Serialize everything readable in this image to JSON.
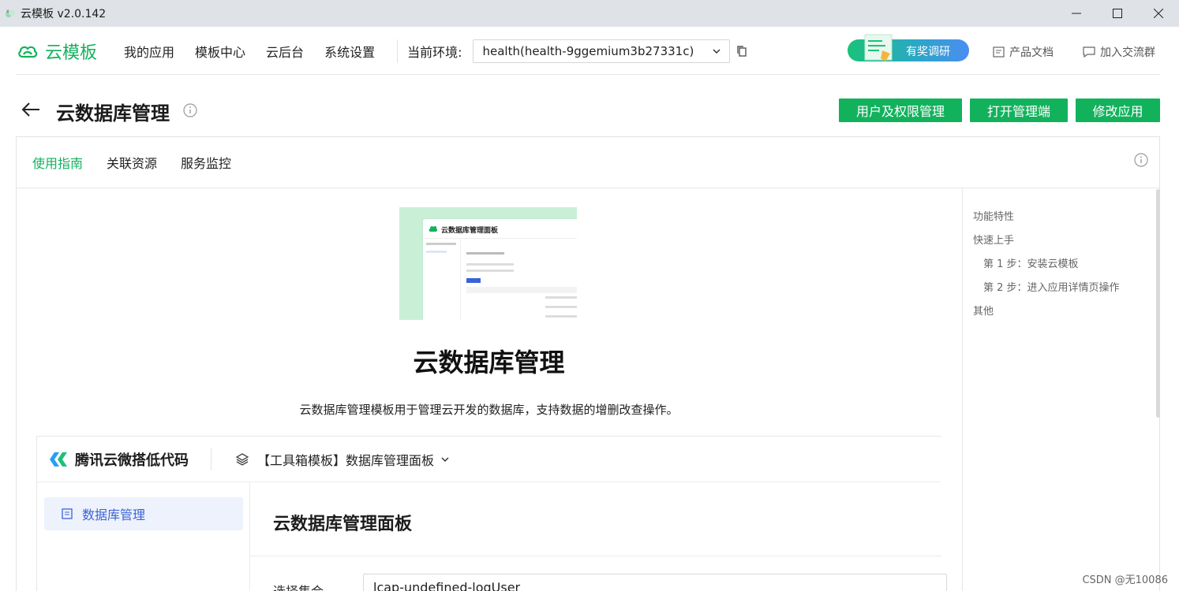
{
  "window": {
    "title": "云模板 v2.0.142"
  },
  "nav": {
    "brand": "云模板",
    "items": [
      "我的应用",
      "模板中心",
      "云后台",
      "系统设置"
    ],
    "env_label": "当前环境:",
    "env_value": "health(health-9ggemium3b27331c)",
    "survey": "有奖调研",
    "docs": "产品文档",
    "community": "加入交流群"
  },
  "header": {
    "title": "云数据库管理",
    "buttons": [
      "用户及权限管理",
      "打开管理端",
      "修改应用"
    ]
  },
  "tabs": {
    "items": [
      "使用指南",
      "关联资源",
      "服务监控"
    ],
    "active": "使用指南"
  },
  "content": {
    "hero_card_title": "云数据库管理面板",
    "heading": "云数据库管理",
    "description": "云数据库管理模板用于管理云开发的数据库，支持数据的增删改查操作。",
    "shot": {
      "brand": "腾讯云微搭低代码",
      "project": "【工具箱模板】数据库管理面板",
      "sidebar_item": "数据库管理",
      "main_title": "云数据库管理面板",
      "field_label": "选择集合",
      "field_value": "lcap-undefined-logUser"
    }
  },
  "toc": {
    "items": [
      "功能特性",
      "快速上手",
      "第 1 步：安装云模板",
      "第 2 步：进入应用详情页操作",
      "其他"
    ]
  },
  "watermark": "CSDN @无10086",
  "colors": {
    "accent": "#12b25d",
    "link_blue": "#3a63d8"
  }
}
